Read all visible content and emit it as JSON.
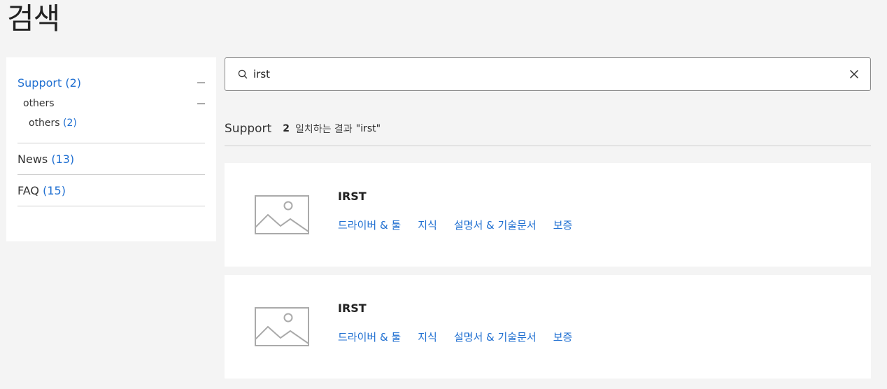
{
  "page": {
    "title": "검색"
  },
  "search": {
    "value": "irst",
    "placeholder": ""
  },
  "sidebar": {
    "support": {
      "label": "Support",
      "count": "(2)"
    },
    "others": {
      "label": "others"
    },
    "others_sub": {
      "label": "others",
      "count": "(2)"
    },
    "categories": [
      {
        "label": "News",
        "count": "(13)"
      },
      {
        "label": "FAQ",
        "count": "(15)"
      }
    ]
  },
  "results_header": {
    "section": "Support",
    "count": "2",
    "text": "일치하는 결과",
    "query": "\"irst\""
  },
  "results": [
    {
      "title": "IRST",
      "links": [
        "드라이버 & 툴",
        "지식",
        "설명서 & 기술문서",
        "보증"
      ]
    },
    {
      "title": "IRST",
      "links": [
        "드라이버 & 툴",
        "지식",
        "설명서 & 기술문서",
        "보증"
      ]
    }
  ],
  "colors": {
    "accent": "#1f6fd1",
    "background": "#f4f4f4"
  }
}
